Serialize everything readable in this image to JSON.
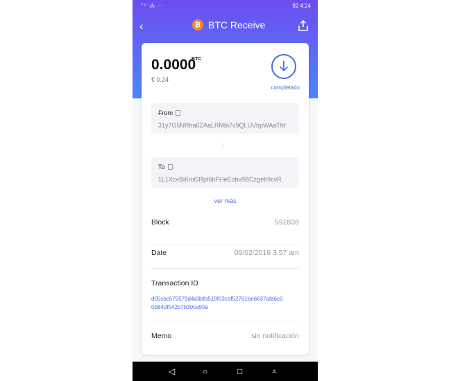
{
  "status_bar": {
    "left": "ᵀᴵˡ ⁂ ··· ",
    "right": "92 4:24"
  },
  "header": {
    "title": "BTC Receive",
    "coin_symbol": "₿"
  },
  "summary": {
    "amount": "0.0000",
    "unit": "BTC",
    "fiat": "€ 0.24",
    "status": "completado"
  },
  "from": {
    "label": "From",
    "address": "31y7G5NRha6ZAaLRMbi7v9QLUVbpWAaThf"
  },
  "to": {
    "label": "To",
    "address": "1L1XcvBiKmGRpt6bFHeEobv9BCzgeb9cvR"
  },
  "more_link": "ver más",
  "details": {
    "block_label": "Block",
    "block_value": "592838",
    "date_label": "Date",
    "date_value": "09/02/2019 3:57 am",
    "txid_label": "Transaction ID",
    "txid_value": "d05cbc575579d4d3bfa519f03caf52761be6637afa6c0 0b84df542b7b30ca90a",
    "memo_label": "Memo",
    "memo_value": "sin notificación"
  },
  "colors": {
    "accent": "#4a6ee0",
    "coin": "#f08b23",
    "hero_top": "#6b4cf0",
    "hero_bottom": "#4a86f7"
  }
}
